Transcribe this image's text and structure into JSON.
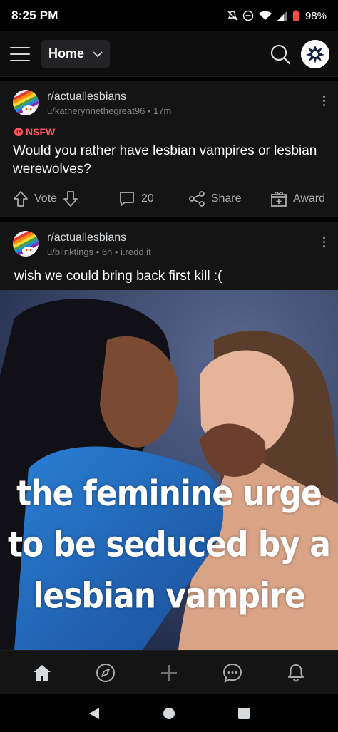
{
  "status_bar": {
    "time": "8:25 PM",
    "battery": "98%"
  },
  "header": {
    "feed_label": "Home"
  },
  "posts": [
    {
      "subreddit": "r/actuallesbians",
      "byline": "u/katherynnethegreat96 • 17m",
      "nsfw_label": "NSFW",
      "title": "Would you rather have lesbian vampires or lesbian werewolves?",
      "vote_label": "Vote",
      "comment_count": "20",
      "share_label": "Share",
      "award_label": "Award"
    },
    {
      "subreddit": "r/actuallesbians",
      "byline": "u/blinktings • 6h • i.redd.it",
      "title": "wish we could bring back first kill :(",
      "image_caption": [
        "the feminine urge",
        "to be seduced by a",
        "lesbian vampire"
      ]
    }
  ],
  "icons": {
    "menu": "menu-icon",
    "chevron": "chevron-down-icon",
    "search": "search-icon",
    "upvote": "upvote-icon",
    "downvote": "downvote-icon",
    "comment": "comment-icon",
    "share": "share-icon",
    "award": "award-icon",
    "home": "home-icon",
    "discover": "compass-icon",
    "create": "plus-icon",
    "chat": "chat-icon",
    "inbox": "bell-icon"
  },
  "colors": {
    "background": "#000000",
    "card": "#141415",
    "nsfw": "#ff585b",
    "text_primary": "#ffffff",
    "text_muted": "#818384"
  }
}
